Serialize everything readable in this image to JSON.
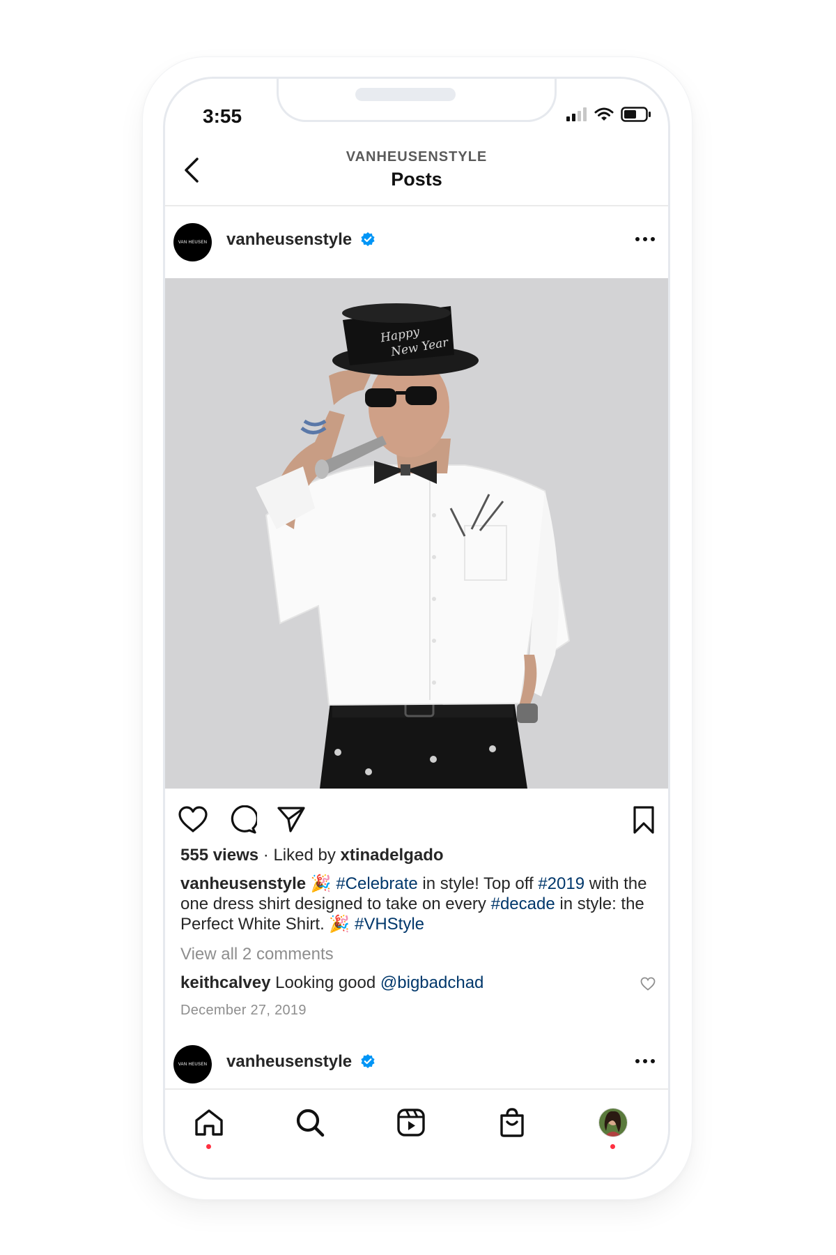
{
  "status_bar": {
    "time": "3:55"
  },
  "header": {
    "subtitle": "VANHEUSENSTYLE",
    "title": "Posts"
  },
  "post": {
    "avatar_text": "VAN HEUSEN",
    "username": "vanheusenstyle",
    "hat_text_1": "Happy",
    "hat_text_2": "New Year",
    "views": "555 views",
    "liked_by_prefix": "Liked by",
    "liked_by_user": "xtinadelgado",
    "caption": {
      "username": "vanheusenstyle",
      "emoji_1": "🎉",
      "tag_1": "#Celebrate",
      "text_1": "in style! Top off",
      "tag_2": "#2019",
      "text_2": "with the one dress shirt designed to take on every",
      "tag_3": "#decade",
      "text_3": "in style: the Perfect White Shirt.",
      "emoji_2": "🎉",
      "tag_4": "#VHStyle"
    },
    "view_comments": "View all 2 comments",
    "comment": {
      "user": "keithcalvey",
      "text": "Looking good",
      "mention": "@bigbadchad"
    },
    "date": "December 27, 2019"
  },
  "next_post": {
    "avatar_text": "VAN HEUSEN",
    "username": "vanheusenstyle"
  },
  "colors": {
    "link": "#00376b",
    "verified": "#0095f6",
    "notification_dot": "#ff3040"
  },
  "bottom_nav": {
    "items": [
      {
        "icon": "home-icon"
      },
      {
        "icon": "search-icon"
      },
      {
        "icon": "reels-icon"
      },
      {
        "icon": "shop-icon"
      },
      {
        "icon": "profile-avatar"
      }
    ]
  }
}
